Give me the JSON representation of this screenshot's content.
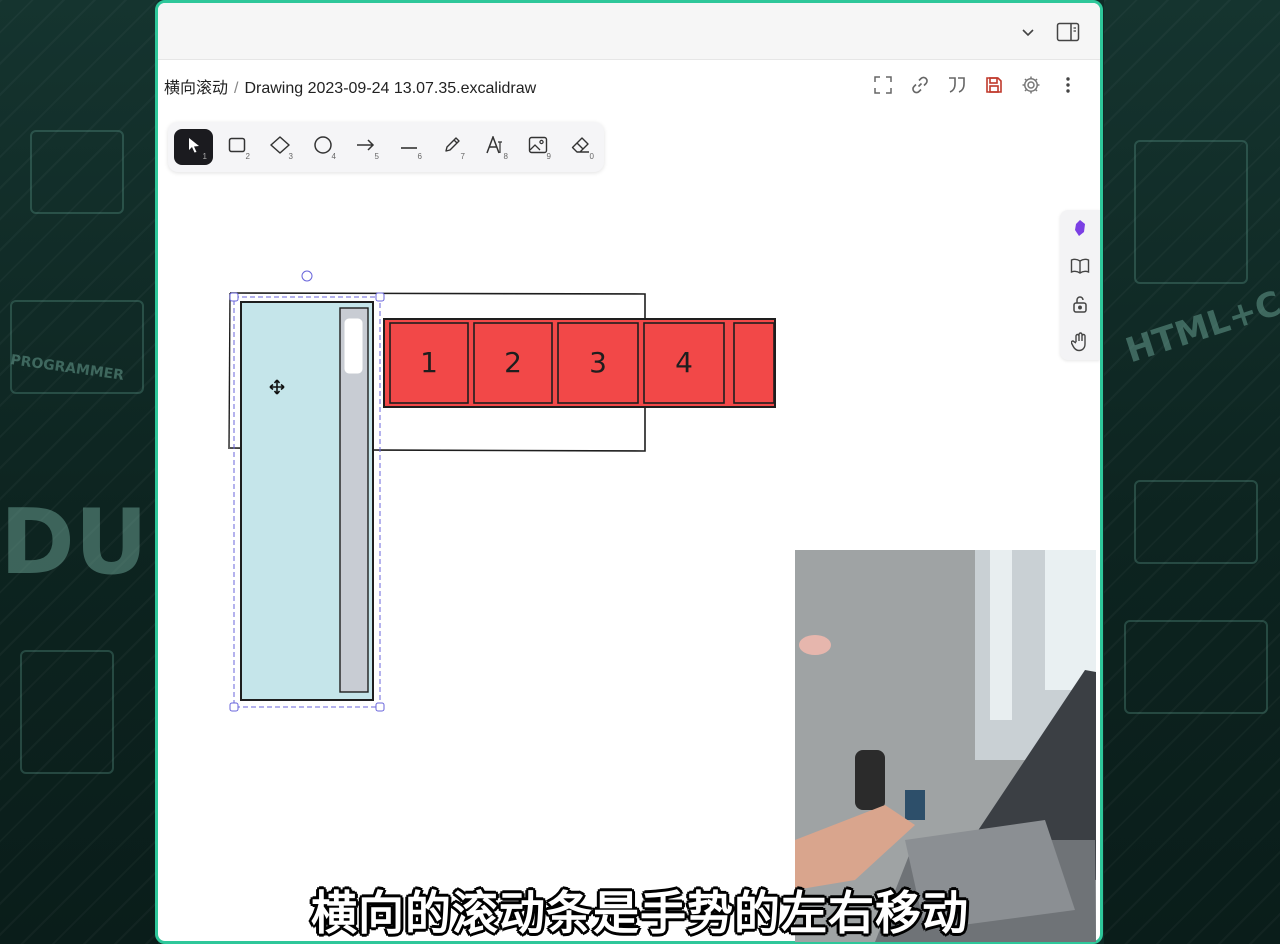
{
  "breadcrumb": {
    "folder": "横向滚动",
    "separator": "/",
    "file": "Drawing 2023-09-24 13.07.35.excalidraw"
  },
  "topbar": {
    "icons": [
      "chevron-down-icon",
      "sidebar-toggle-icon"
    ]
  },
  "header_actions": [
    "fullscreen-icon",
    "link-icon",
    "quote-icon",
    "save-icon",
    "settings-icon",
    "more-icon"
  ],
  "toolbar": {
    "tools": [
      {
        "icon": "selection-icon",
        "key": "1",
        "active": true
      },
      {
        "icon": "rectangle-icon",
        "key": "2"
      },
      {
        "icon": "diamond-icon",
        "key": "3"
      },
      {
        "icon": "ellipse-icon",
        "key": "4"
      },
      {
        "icon": "arrow-icon",
        "key": "5"
      },
      {
        "icon": "line-icon",
        "key": "6"
      },
      {
        "icon": "pencil-icon",
        "key": "7"
      },
      {
        "icon": "text-icon",
        "key": "8"
      },
      {
        "icon": "image-icon",
        "key": "9"
      },
      {
        "icon": "eraser-icon",
        "key": "0"
      }
    ]
  },
  "side_panel": [
    "obsidian-icon",
    "book-icon",
    "lock-icon",
    "hand-icon"
  ],
  "drawing": {
    "boxes": [
      "1",
      "2",
      "3",
      "4",
      ""
    ],
    "box_color": "#f24848",
    "panel_color": "#c5e5ea",
    "scrollbar_color": "#c8ccd3"
  },
  "subtitle": "横向的滚动条是手势的左右移动",
  "colors": {
    "frame_border": "#2ec79a",
    "save_icon": "#c0392b",
    "obsidian_purple": "#7b3fe4"
  }
}
